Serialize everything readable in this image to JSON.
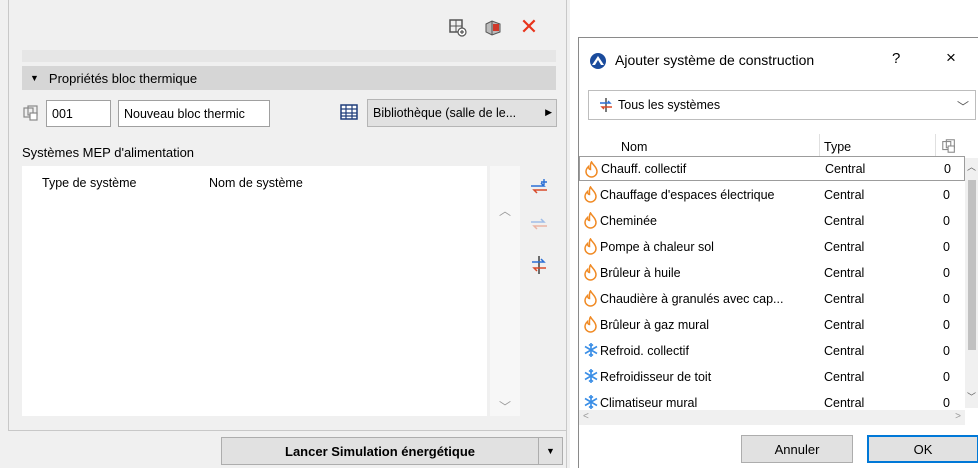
{
  "left_panel": {
    "section_title": "Propriétés bloc thermique",
    "bloc_id": "001",
    "bloc_name": "Nouveau bloc thermic",
    "library_button": "Bibliothèque (salle de le...",
    "mep_label": "Systèmes MEP d'alimentation",
    "columns": [
      "Type de système",
      "Nom de système"
    ],
    "simulate_button": "Lancer Simulation énergétique",
    "icons": [
      "add-zone-icon",
      "3d-block-icon",
      "close-icon",
      "library-grid-icon",
      "add-system-icon",
      "remove-system-icon",
      "split-system-icon"
    ]
  },
  "dialog": {
    "title": "Ajouter système de construction",
    "help": "?",
    "close": "×",
    "filter": "Tous les systèmes",
    "columns": {
      "name": "Nom",
      "type": "Type"
    },
    "rows": [
      {
        "name": "Chauff. collectif",
        "type": "Central",
        "count": "0",
        "icon": "flame-icon",
        "selected": true
      },
      {
        "name": "Chauffage d'espaces électrique",
        "type": "Central",
        "count": "0",
        "icon": "flame-icon"
      },
      {
        "name": "Cheminée",
        "type": "Central",
        "count": "0",
        "icon": "flame-icon"
      },
      {
        "name": "Pompe à chaleur sol",
        "type": "Central",
        "count": "0",
        "icon": "flame-icon"
      },
      {
        "name": "Brûleur à huile",
        "type": "Central",
        "count": "0",
        "icon": "flame-icon"
      },
      {
        "name": "Chaudière à granulés avec cap...",
        "type": "Central",
        "count": "0",
        "icon": "flame-icon"
      },
      {
        "name": "Brûleur à gaz mural",
        "type": "Central",
        "count": "0",
        "icon": "flame-icon"
      },
      {
        "name": "Refroid. collectif",
        "type": "Central",
        "count": "0",
        "icon": "snowflake-icon"
      },
      {
        "name": "Refroidisseur de toit",
        "type": "Central",
        "count": "0",
        "icon": "snowflake-icon"
      },
      {
        "name": "Climatiseur mural",
        "type": "Central",
        "count": "0",
        "icon": "snowflake-icon"
      }
    ],
    "cancel_button": "Annuler",
    "ok_button": "OK"
  },
  "colors": {
    "close_red": "#e8341c",
    "flame_orange": "#f08a24",
    "snow_blue": "#3a8ee6",
    "accent": "#0078d7"
  }
}
